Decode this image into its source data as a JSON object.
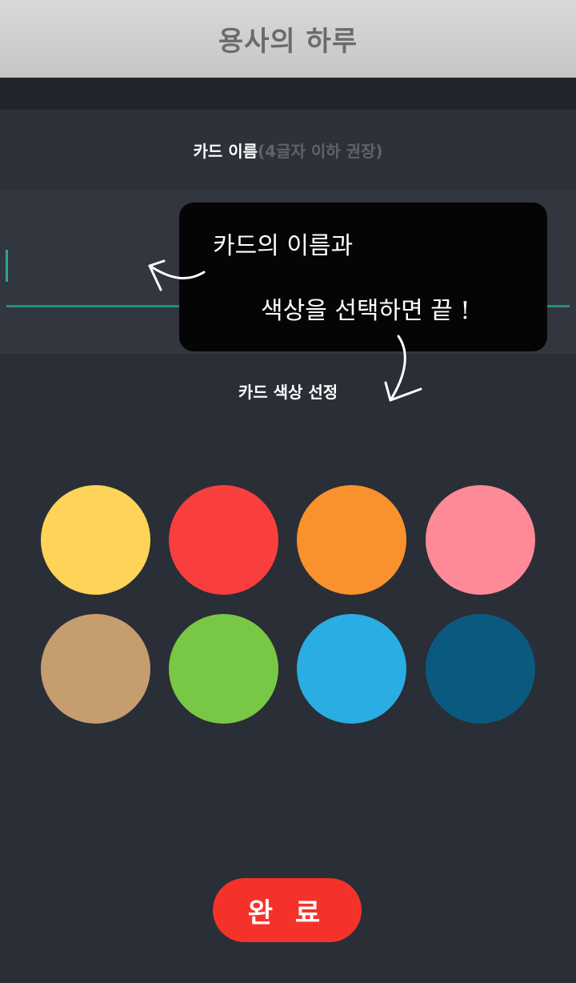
{
  "header": {
    "title": "용사의 하루"
  },
  "card_name": {
    "label": "카드 이름",
    "hint": "(4글자 이하 권장)",
    "value": ""
  },
  "tooltip": {
    "line1": "카드의 이름과",
    "line2": "색상을 선택하면 끝 !"
  },
  "card_color": {
    "title": "카드 색상 선정",
    "colors": [
      "#fdd457",
      "#f83f3d",
      "#f9912d",
      "#fe8a98",
      "#c59d6f",
      "#79c845",
      "#2aade3",
      "#0a5a80"
    ]
  },
  "done_label": "완 료",
  "accent_color": "#1f8e7f",
  "button_color": "#f5322a"
}
